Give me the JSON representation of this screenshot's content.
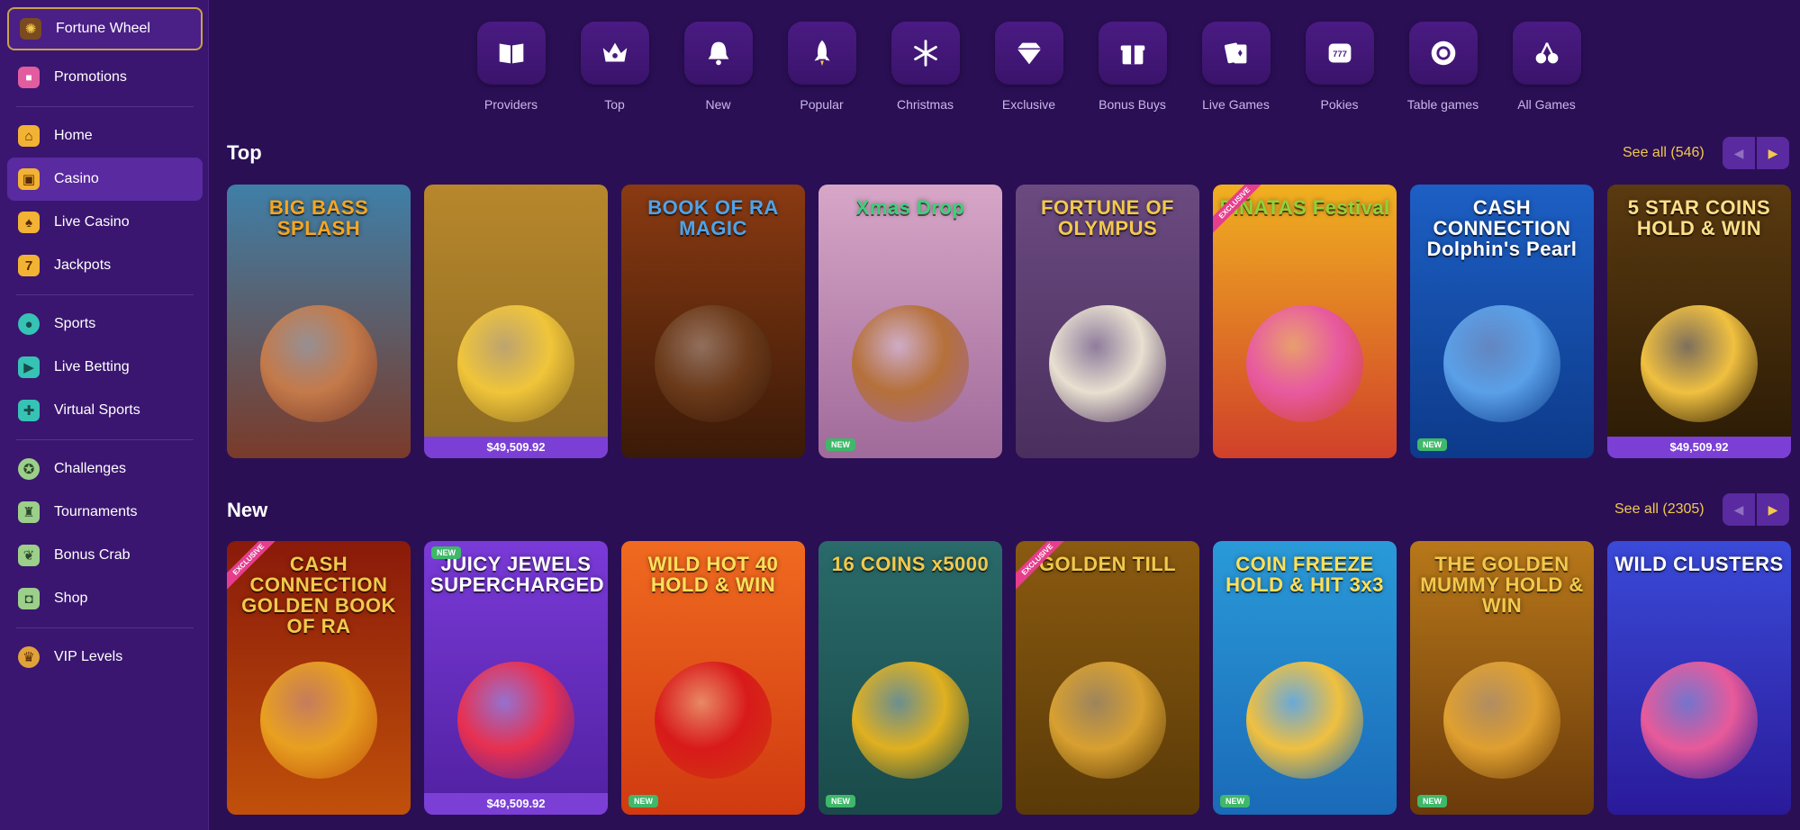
{
  "sidebar": {
    "items": [
      {
        "label": "Fortune Wheel",
        "icon": "fortune-wheel-icon",
        "glyph": "✺",
        "color": "#e0a23a"
      },
      {
        "label": "Promotions",
        "icon": "gift-icon",
        "glyph": "🎁",
        "color": "#e25ca0"
      },
      {
        "label": "Home",
        "icon": "home-icon",
        "glyph": "⌂",
        "color": "#f2b233"
      },
      {
        "label": "Casino",
        "icon": "slot-machine-icon",
        "glyph": "▣",
        "color": "#f2b233"
      },
      {
        "label": "Live Casino",
        "icon": "live-casino-icon",
        "glyph": "♠",
        "color": "#f2b233"
      },
      {
        "label": "Jackpots",
        "icon": "jackpot-icon",
        "glyph": "7",
        "color": "#f2b233"
      },
      {
        "label": "Sports",
        "icon": "soccer-ball-icon",
        "glyph": "⚽",
        "color": "#36c2b4"
      },
      {
        "label": "Live Betting",
        "icon": "live-betting-icon",
        "glyph": "▶",
        "color": "#36c2b4"
      },
      {
        "label": "Virtual Sports",
        "icon": "gamepad-icon",
        "glyph": "🎮",
        "color": "#36c2b4"
      },
      {
        "label": "Challenges",
        "icon": "challenge-icon",
        "glyph": "✪",
        "color": "#9ccf8a"
      },
      {
        "label": "Tournaments",
        "icon": "trophy-icon",
        "glyph": "🏆",
        "color": "#9ccf8a"
      },
      {
        "label": "Bonus Crab",
        "icon": "crab-claw-icon",
        "glyph": "🦀",
        "color": "#9ccf8a"
      },
      {
        "label": "Shop",
        "icon": "shop-bag-icon",
        "glyph": "👜",
        "color": "#9ccf8a"
      },
      {
        "label": "VIP Levels",
        "icon": "vip-crown-icon",
        "glyph": "♛",
        "color": "#e0a23a"
      }
    ]
  },
  "categories": [
    {
      "label": "Providers",
      "icon": "book-icon"
    },
    {
      "label": "Top",
      "icon": "crown-icon"
    },
    {
      "label": "New",
      "icon": "bell-icon"
    },
    {
      "label": "Popular",
      "icon": "rocket-icon"
    },
    {
      "label": "Christmas",
      "icon": "snowflake-icon"
    },
    {
      "label": "Exclusive",
      "icon": "diamond-icon"
    },
    {
      "label": "Bonus Buys",
      "icon": "gift-box-icon"
    },
    {
      "label": "Live Games",
      "icon": "cards-icon"
    },
    {
      "label": "Pokies",
      "icon": "slot-777-icon"
    },
    {
      "label": "Table games",
      "icon": "chip-icon"
    },
    {
      "label": "All Games",
      "icon": "cherries-icon"
    }
  ],
  "sections": {
    "top": {
      "title": "Top",
      "see_all": "See all (546)",
      "games": [
        {
          "title": "BIG BASS SPLASH",
          "bg": "#3f7fa8",
          "bg2": "#7a3b2a",
          "title_color": "#f5a623",
          "art": "#c47a4a"
        },
        {
          "title": "",
          "bg": "#b8872c",
          "bg2": "#8a6a22",
          "title_color": "#ffd25a",
          "art": "#f0c53a",
          "jackpot": "$49,509.92"
        },
        {
          "title": "BOOK OF RA MAGIC",
          "bg": "#8a3a12",
          "bg2": "#3a1a08",
          "title_color": "#4fa3e8",
          "art": "#6b3a1a"
        },
        {
          "title": "Xmas Drop",
          "bg": "#d7a6c7",
          "bg2": "#a06a9a",
          "title_color": "#3fcf7a",
          "art": "#b5703a",
          "badge": "NEW"
        },
        {
          "title": "FORTUNE OF OLYMPUS",
          "bg": "#6b4a80",
          "bg2": "#4a2f5e",
          "title_color": "#f2c94c",
          "art": "#e8e0d0"
        },
        {
          "title": "PIÑATAS Festival",
          "bg": "#f0b020",
          "bg2": "#d0402a",
          "title_color": "#8fd13a",
          "art": "#e85aa0",
          "ribbon": "EXCLUSIVE"
        },
        {
          "title": "CASH CONNECTION Dolphin's Pearl",
          "bg": "#1d5fc4",
          "bg2": "#0d3a8a",
          "title_color": "#ffffff",
          "art": "#5aa0e8",
          "badge": "NEW"
        },
        {
          "title": "5 STAR COINS HOLD & WIN",
          "bg": "#5a3a10",
          "bg2": "#2a1a05",
          "title_color": "#ffe08a",
          "art": "#f0c040",
          "jackpot": "$49,509.92"
        }
      ]
    },
    "new": {
      "title": "New",
      "see_all": "See all (2305)",
      "games": [
        {
          "title": "CASH CONNECTION GOLDEN BOOK OF RA",
          "bg": "#8a1a0a",
          "bg2": "#c0500a",
          "title_color": "#f2c94c",
          "art": "#e8a020",
          "ribbon": "EXCLUSIVE"
        },
        {
          "title": "JUICY JEWELS SUPERCHARGED",
          "bg": "#7a3ad8",
          "bg2": "#5020a0",
          "title_color": "#ffffff",
          "art": "#e83050",
          "badge_top": "NEW",
          "jackpot": "$49,509.92"
        },
        {
          "title": "WILD HOT 40 HOLD & WIN",
          "bg": "#f06a20",
          "bg2": "#d03a10",
          "title_color": "#ffe05a",
          "art": "#d81a1a",
          "badge": "NEW"
        },
        {
          "title": "16 COINS x5000",
          "bg": "#2a6a6a",
          "bg2": "#1a4a4a",
          "title_color": "#f2c94c",
          "art": "#e0b020",
          "badge": "NEW"
        },
        {
          "title": "GOLDEN TILL",
          "bg": "#8a5a10",
          "bg2": "#5a3a08",
          "title_color": "#f2c94c",
          "art": "#d8a030",
          "ribbon": "EXCLUSIVE"
        },
        {
          "title": "COIN FREEZE HOLD & HIT 3x3",
          "bg": "#2a9ad8",
          "bg2": "#1a6ab8",
          "title_color": "#ffe05a",
          "art": "#f0c040",
          "badge": "NEW"
        },
        {
          "title": "THE GOLDEN MUMMY HOLD & WIN",
          "bg": "#b8781a",
          "bg2": "#6a3a0a",
          "title_color": "#f2c94c",
          "art": "#e0a030",
          "badge": "NEW"
        },
        {
          "title": "WILD CLUSTERS",
          "bg": "#3a4ad8",
          "bg2": "#2a1a9a",
          "title_color": "#ffffff",
          "art": "#e85a9a"
        }
      ]
    }
  },
  "colors": {
    "accent": "#f2c94c",
    "background": "#2a0f55",
    "sidebar": "#3a1670",
    "new_badge": "#3fb86a",
    "jackpot_bar": "#7b3fd6"
  }
}
